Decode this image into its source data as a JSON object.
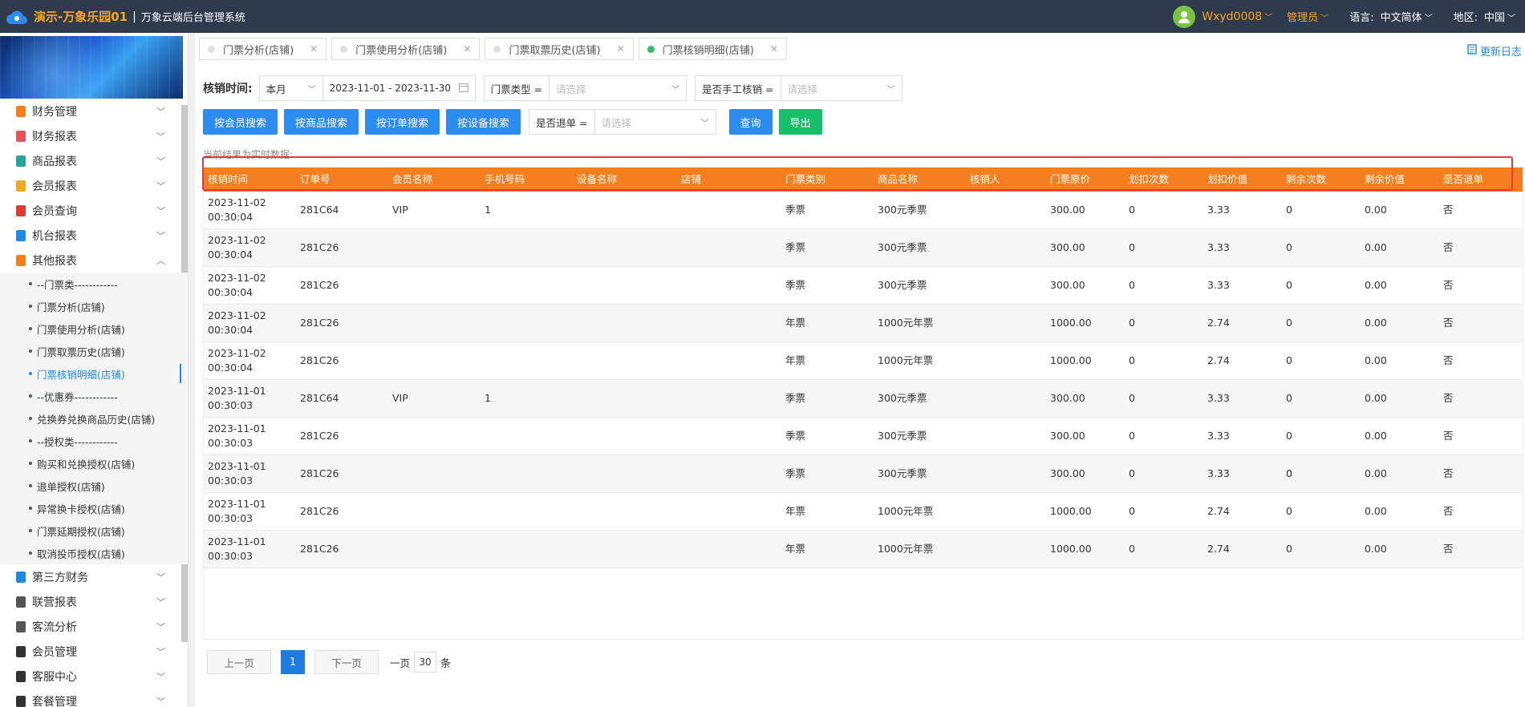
{
  "header": {
    "brand": "演示-万象乐园01",
    "separator": "|",
    "subtitle": "万象云端后台管理系统",
    "user": "Wxyd0008",
    "role": "管理员",
    "language_label": "语言:",
    "language_value": "中文简体",
    "region_label": "地区:",
    "region_value": "中国"
  },
  "sidebar": {
    "menus_top": [
      {
        "label": "财务管理",
        "color": "#f57f20",
        "chev": "﹀"
      },
      {
        "label": "财务报表",
        "color": "#e8505b",
        "chev": "﹀"
      },
      {
        "label": "商品报表",
        "color": "#26a69a",
        "chev": "﹀"
      },
      {
        "label": "会员报表",
        "color": "#f5a623",
        "chev": "﹀"
      },
      {
        "label": "会员查询",
        "color": "#e53935",
        "chev": "﹀"
      },
      {
        "label": "机台报表",
        "color": "#1e88e5",
        "chev": "﹀"
      },
      {
        "label": "其他报表",
        "color": "#f57f20",
        "chev": "︿"
      }
    ],
    "subitems": [
      "--门票类------------",
      "门票分析(店铺)",
      "门票使用分析(店铺)",
      "门票取票历史(店铺)",
      "门票核销明细(店铺)",
      "--优惠券------------",
      "兑换券兑换商品历史(店铺)",
      "--授权类------------",
      "购买和兑换授权(店铺)",
      "退单授权(店铺)",
      "异常换卡授权(店铺)",
      "门票延期授权(店铺)",
      "取消投币授权(店铺)"
    ],
    "menus_bottom": [
      {
        "label": "第三方财务",
        "color": "#1e88e5"
      },
      {
        "label": "联营报表",
        "color": "#555"
      },
      {
        "label": "客流分析",
        "color": "#555"
      },
      {
        "label": "会员管理",
        "color": "#333"
      },
      {
        "label": "客服中心",
        "color": "#333"
      },
      {
        "label": "套餐管理",
        "color": "#333"
      }
    ]
  },
  "tabs": [
    {
      "label": "门票分析(店铺)",
      "close": "✕"
    },
    {
      "label": "门票使用分析(店铺)",
      "close": "✕"
    },
    {
      "label": "门票取票历史(店铺)",
      "close": "✕"
    },
    {
      "label": "门票核销明细(店铺)",
      "close": "✕"
    }
  ],
  "changelog": "更新日志",
  "filters": {
    "time_label": "核销时间:",
    "period": "本月",
    "date_range": "2023-11-01 - 2023-11-30",
    "ticket_type_label": "门票类型 =",
    "ticket_type_placeholder": "请选择",
    "manual_label": "是否手工核销 =",
    "manual_placeholder": "请选择",
    "refund_label": "是否退单 =",
    "refund_placeholder": "请选择"
  },
  "buttons": {
    "by_member": "按会员搜索",
    "by_product": "按商品搜索",
    "by_order": "按订单搜索",
    "by_device": "按设备搜索",
    "query": "查询",
    "export": "导出"
  },
  "realtime_note": "当前结果为实时数据:",
  "table": {
    "columns": [
      "核销时间",
      "订单号",
      "会员名称",
      "手机号码",
      "设备名称",
      "店铺",
      "门票类别",
      "商品名称",
      "核销人",
      "门票原价",
      "划扣次数",
      "划扣价值",
      "剩余次数",
      "剩余价值",
      "是否退单"
    ],
    "rows": [
      [
        "2023-11-02 00:30:04",
        "281C64",
        "VIP",
        "1",
        "",
        "",
        "季票",
        "300元季票",
        "",
        "300.00",
        "0",
        "3.33",
        "0",
        "0.00",
        "否"
      ],
      [
        "2023-11-02 00:30:04",
        "281C26",
        "",
        "",
        "",
        "",
        "季票",
        "300元季票",
        "",
        "300.00",
        "0",
        "3.33",
        "0",
        "0.00",
        "否"
      ],
      [
        "2023-11-02 00:30:04",
        "281C26",
        "",
        "",
        "",
        "",
        "季票",
        "300元季票",
        "",
        "300.00",
        "0",
        "3.33",
        "0",
        "0.00",
        "否"
      ],
      [
        "2023-11-02 00:30:04",
        "281C26",
        "",
        "",
        "",
        "",
        "年票",
        "1000元年票",
        "",
        "1000.00",
        "0",
        "2.74",
        "0",
        "0.00",
        "否"
      ],
      [
        "2023-11-02 00:30:04",
        "281C26",
        "",
        "",
        "",
        "",
        "年票",
        "1000元年票",
        "",
        "1000.00",
        "0",
        "2.74",
        "0",
        "0.00",
        "否"
      ],
      [
        "2023-11-01 00:30:03",
        "281C64",
        "VIP",
        "1",
        "",
        "",
        "季票",
        "300元季票",
        "",
        "300.00",
        "0",
        "3.33",
        "0",
        "0.00",
        "否"
      ],
      [
        "2023-11-01 00:30:03",
        "281C26",
        "",
        "",
        "",
        "",
        "季票",
        "300元季票",
        "",
        "300.00",
        "0",
        "3.33",
        "0",
        "0.00",
        "否"
      ],
      [
        "2023-11-01 00:30:03",
        "281C26",
        "",
        "",
        "",
        "",
        "季票",
        "300元季票",
        "",
        "300.00",
        "0",
        "3.33",
        "0",
        "0.00",
        "否"
      ],
      [
        "2023-11-01 00:30:03",
        "281C26",
        "",
        "",
        "",
        "",
        "年票",
        "1000元年票",
        "",
        "1000.00",
        "0",
        "2.74",
        "0",
        "0.00",
        "否"
      ],
      [
        "2023-11-01 00:30:03",
        "281C26",
        "",
        "",
        "",
        "",
        "年票",
        "1000元年票",
        "",
        "1000.00",
        "0",
        "2.74",
        "0",
        "0.00",
        "否"
      ]
    ]
  },
  "pagination": {
    "prev": "上一页",
    "current": "1",
    "next": "下一页",
    "per_page_prefix": "一页",
    "per_page": "30",
    "per_page_suffix": "条"
  },
  "colors": {
    "topbar": "#2f3a4c",
    "brand": "#f5a623",
    "table_header": "#f57f20",
    "primary": "#2d8cf0",
    "success": "#19be6b",
    "highlight": "#e23b3b"
  }
}
